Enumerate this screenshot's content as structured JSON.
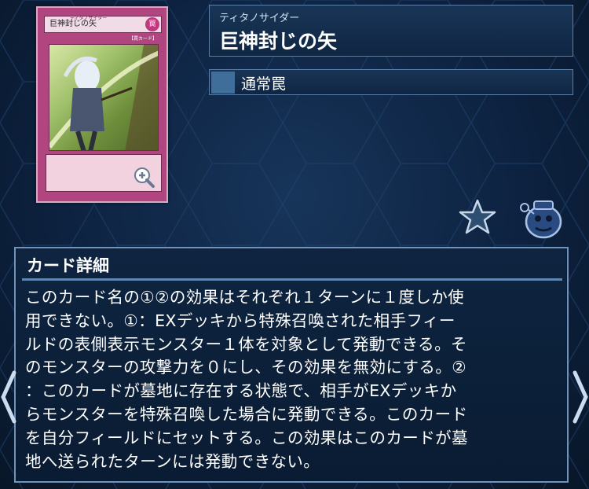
{
  "card_image": {
    "name": "巨神封じの矢",
    "ruby": "ティタノサイダー",
    "attribute": "罠",
    "type_line": "【罠カード】"
  },
  "header": {
    "ruby": "ティタノサイダー",
    "card_name": "巨神封じの矢",
    "type_label": "通常罠"
  },
  "actions": {
    "favorite_icon": "star-icon",
    "deck_icon": "pot-icon"
  },
  "detail": {
    "title": "カード詳細",
    "lines": [
      "このカード名の①②の効果はそれぞれ１ターンに１度しか使",
      "用できない。①：EXデッキから特殊召喚された相手フィー",
      "ルドの表側表示モンスター１体を対象として発動できる。そ",
      "のモンスターの攻撃力を０にし、その効果を無効にする。②",
      "：このカードが墓地に存在する状態で、相手がEXデッキか",
      "らモンスターを特殊召喚した場合に発動できる。このカード",
      "を自分フィールドにセットする。この効果はこのカードが墓",
      "地へ送られたターンには発動できない。"
    ]
  },
  "nav": {
    "prev_icon": "chevron-left-icon",
    "next_icon": "chevron-right-icon"
  },
  "colors": {
    "trap_card": "#b0457f",
    "panel_border": "#6e94bd",
    "type_swatch": "#3e6e99",
    "background": "#0d2240"
  }
}
